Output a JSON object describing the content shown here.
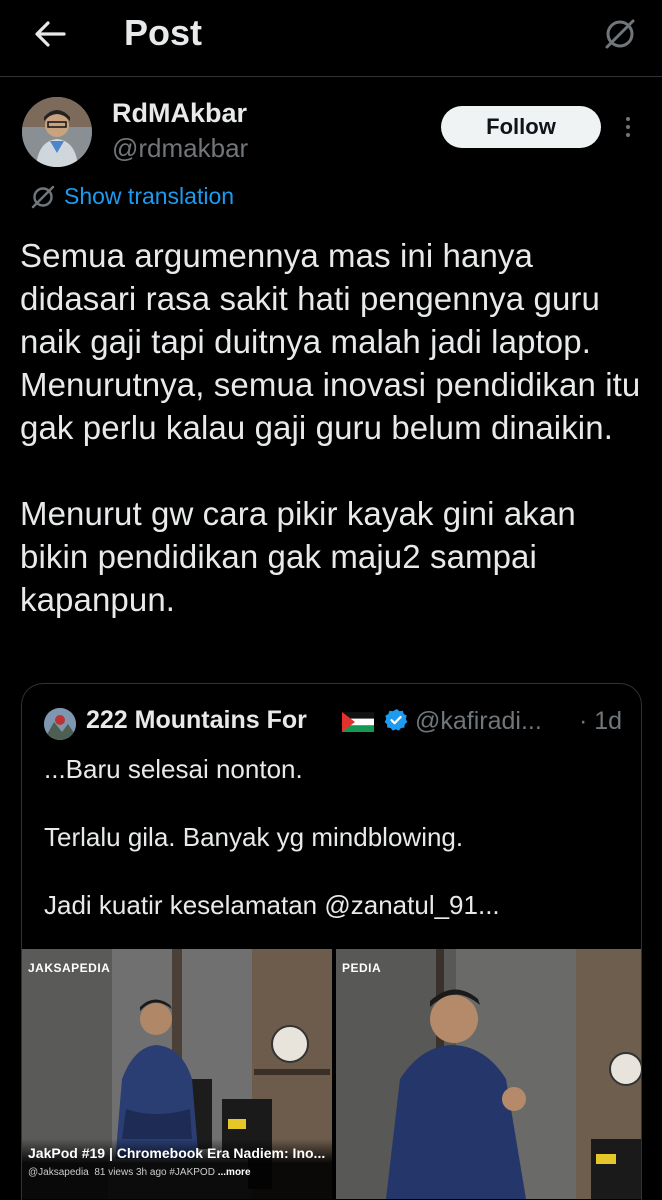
{
  "header": {
    "title": "Post",
    "back_icon": "back-arrow-icon",
    "grok_icon": "grok-icon"
  },
  "author": {
    "name": "RdMAkbar",
    "handle": "@rdmakbar",
    "follow_label": "Follow"
  },
  "translation": {
    "label": "Show translation",
    "icon": "translate-globe-icon"
  },
  "post": {
    "text": "Semua argumennya mas ini hanya didasari rasa sakit hati pengennya guru naik gaji tapi duitnya malah jadi laptop. Menurutnya, semua inovasi pendidikan itu gak perlu kalau gaji guru belum dinaikin.\n\nMenurut gw cara pikir kayak gini akan bikin pendidikan gak maju2 sampai kapanpun."
  },
  "quote": {
    "name": "222 Mountains For",
    "handle": "@kafiradi...",
    "separator": "·",
    "time": "1d",
    "text": "...Baru selesai nonton.\n\nTerlalu gila. Banyak yg mindblowing.\n\nJadi kuatir keselamatan @zanatul_91...",
    "media": {
      "logo_left": "JAKSAPEDIA",
      "logo_right": "PEDIA",
      "video_title": "JakPod #19 | Chromebook Era Nadiem: Ino...",
      "video_channel": "@Jaksapedia",
      "video_meta": "81 views 3h ago #JAKPOD",
      "video_more": "...more"
    }
  },
  "colors": {
    "background": "#000000",
    "accent": "#1d9bf0",
    "text": "#e7e9ea",
    "muted": "#71767b"
  }
}
